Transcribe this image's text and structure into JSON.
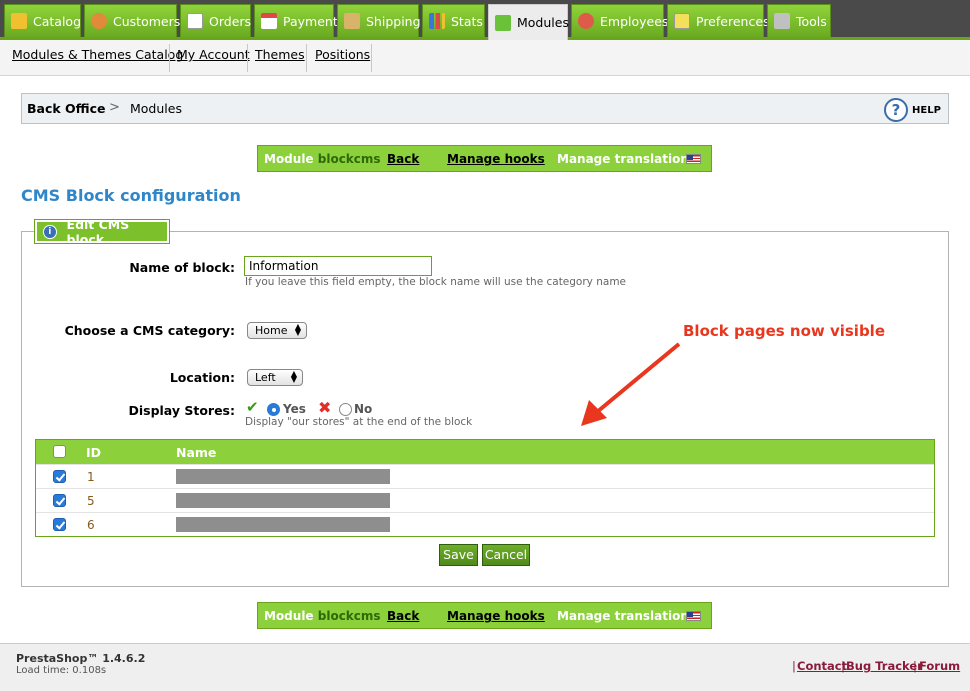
{
  "tabs": [
    {
      "label": "Catalog",
      "icon": "catalog-icon",
      "color": "#f0c030"
    },
    {
      "label": "Customers",
      "icon": "customers-icon",
      "color": "#e08a3a"
    },
    {
      "label": "Orders",
      "icon": "orders-icon",
      "color": "#ffffff"
    },
    {
      "label": "Payment",
      "icon": "payment-icon",
      "color": "#e04848"
    },
    {
      "label": "Shipping",
      "icon": "shipping-icon",
      "color": "#d9b36a"
    },
    {
      "label": "Stats",
      "icon": "stats-icon",
      "color": "#3a78d8"
    },
    {
      "label": "Modules",
      "icon": "puzzle-icon",
      "color": "#6ac23a"
    },
    {
      "label": "Employees",
      "icon": "employees-icon",
      "color": "#e05a4a"
    },
    {
      "label": "Preferences",
      "icon": "preferences-icon",
      "color": "#f2e05a"
    },
    {
      "label": "Tools",
      "icon": "tools-icon",
      "color": "#c0c0c0"
    }
  ],
  "submenu": [
    "Modules & Themes Catalog",
    "My Account",
    "Themes",
    "Positions"
  ],
  "breadcrumb": {
    "home": "Back Office",
    "separator": ">",
    "current": "Modules",
    "help": "HELP"
  },
  "module_bar": {
    "prefix": "Module ",
    "name": "blockcms",
    "back": "Back",
    "hooks": "Manage hooks",
    "translations": "Manage translations:"
  },
  "page_title": "CMS Block configuration",
  "legend": "Edit CMS block",
  "form": {
    "name_label": "Name of block:",
    "name_value": "Information",
    "name_hint": "If you leave this field empty, the block name will use the category name",
    "category_label": "Choose a CMS category:",
    "category_value": "Home",
    "location_label": "Location:",
    "location_value": "Left",
    "stores_label": "Display Stores:",
    "yes": "Yes",
    "no": "No",
    "stores_hint": "Display \"our stores\" at the end of the block",
    "stores_selected": "Yes"
  },
  "annotation": "Block pages now visible",
  "table": {
    "headers": {
      "id": "ID",
      "name": "Name"
    },
    "rows": [
      {
        "id": "1",
        "checked": true
      },
      {
        "id": "5",
        "checked": true
      },
      {
        "id": "6",
        "checked": true
      }
    ]
  },
  "buttons": {
    "save": "Save",
    "cancel": "Cancel"
  },
  "footer": {
    "version": "PrestaShop™ 1.4.6.2",
    "load_time": "Load time: 0.108s",
    "links": [
      "Contact",
      "Bug Tracker",
      "Forum"
    ]
  },
  "colors": {
    "accent_green": "#8cd13b",
    "title_blue": "#2f86c8",
    "annotation_red": "#e8371e"
  }
}
